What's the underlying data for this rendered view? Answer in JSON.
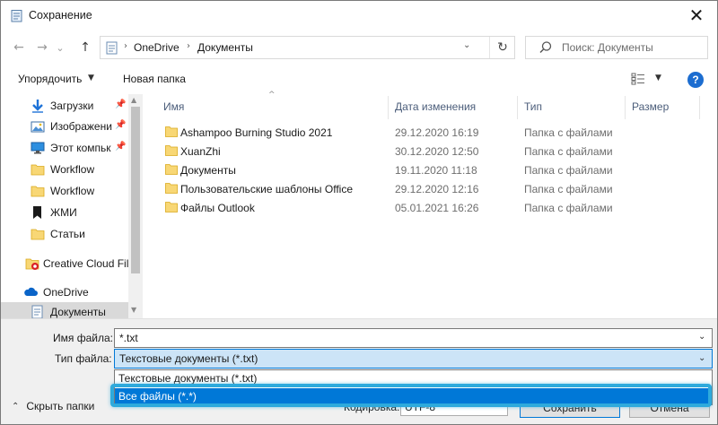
{
  "window": {
    "title": "Сохранение",
    "close_glyph": "✕"
  },
  "nav": {
    "back_glyph": "←",
    "forward_glyph": "→",
    "recent_glyph": "⌄",
    "up_glyph": "↑",
    "breadcrumbs": [
      "OneDrive",
      "Документы"
    ],
    "separator": "›",
    "address_dropdown_glyph": "⌄",
    "refresh_glyph": "↻",
    "search_placeholder": "Поиск: Документы"
  },
  "toolbar": {
    "organize_label": "Упорядочить",
    "organize_arrow": "▼",
    "new_folder_label": "Новая папка",
    "view_arrow": "▼",
    "help_label": "?"
  },
  "sidebar": {
    "pin_glyph": "📌",
    "items": [
      {
        "label": "Загрузки",
        "icon": "download-icon",
        "pinned": true
      },
      {
        "label": "Изображени",
        "icon": "pictures-icon",
        "pinned": true
      },
      {
        "label": "Этот компьк",
        "icon": "computer-icon",
        "pinned": true
      },
      {
        "label": "Workflow",
        "icon": "folder-icon",
        "pinned": false
      },
      {
        "label": "Workflow",
        "icon": "folder-icon",
        "pinned": false
      },
      {
        "label": "ЖМИ",
        "icon": "bookmark-icon",
        "pinned": false
      },
      {
        "label": "Статьи",
        "icon": "folder-icon",
        "pinned": false
      },
      {
        "label": "Creative Cloud Fil",
        "icon": "creative-cloud-icon",
        "pinned": false
      },
      {
        "label": "OneDrive",
        "icon": "onedrive-icon",
        "pinned": false
      },
      {
        "label": "Документы",
        "icon": "document-icon",
        "pinned": false,
        "selected": true
      }
    ],
    "scroll_up": "▲",
    "scroll_down": "▼"
  },
  "files": {
    "sort_glyph": "^",
    "columns": [
      "Имя",
      "Дата изменения",
      "Тип",
      "Размер"
    ],
    "rows": [
      {
        "name": "Ashampoo Burning Studio 2021",
        "date": "29.12.2020 16:19",
        "type": "Папка с файлами"
      },
      {
        "name": "XuanZhi",
        "date": "30.12.2020 12:50",
        "type": "Папка с файлами"
      },
      {
        "name": "Документы",
        "date": "19.11.2020 11:18",
        "type": "Папка с файлами"
      },
      {
        "name": "Пользовательские шаблоны Office",
        "date": "29.12.2020 12:16",
        "type": "Папка с файлами"
      },
      {
        "name": "Файлы Outlook",
        "date": "05.01.2021 16:26",
        "type": "Папка с файлами"
      }
    ]
  },
  "form": {
    "filename_label": "Имя файла:",
    "filename_value": "*.txt",
    "filetype_label": "Тип файла:",
    "filetype_value": "Текстовые документы (*.txt)",
    "dropdown_glyph": "⌄",
    "options": [
      "Текстовые документы (*.txt)",
      "Все файлы  (*.*)"
    ],
    "hide_folders_glyph": "⌃",
    "hide_folders_label": "Скрыть папки",
    "encoding_label": "Кодировка:",
    "encoding_value": "UTF-8",
    "save_label": "Сохранить",
    "cancel_label": "Отмена"
  },
  "colors": {
    "accent": "#0078d7",
    "highlight_frame": "#2eaadc",
    "folder": "#f8d775"
  }
}
